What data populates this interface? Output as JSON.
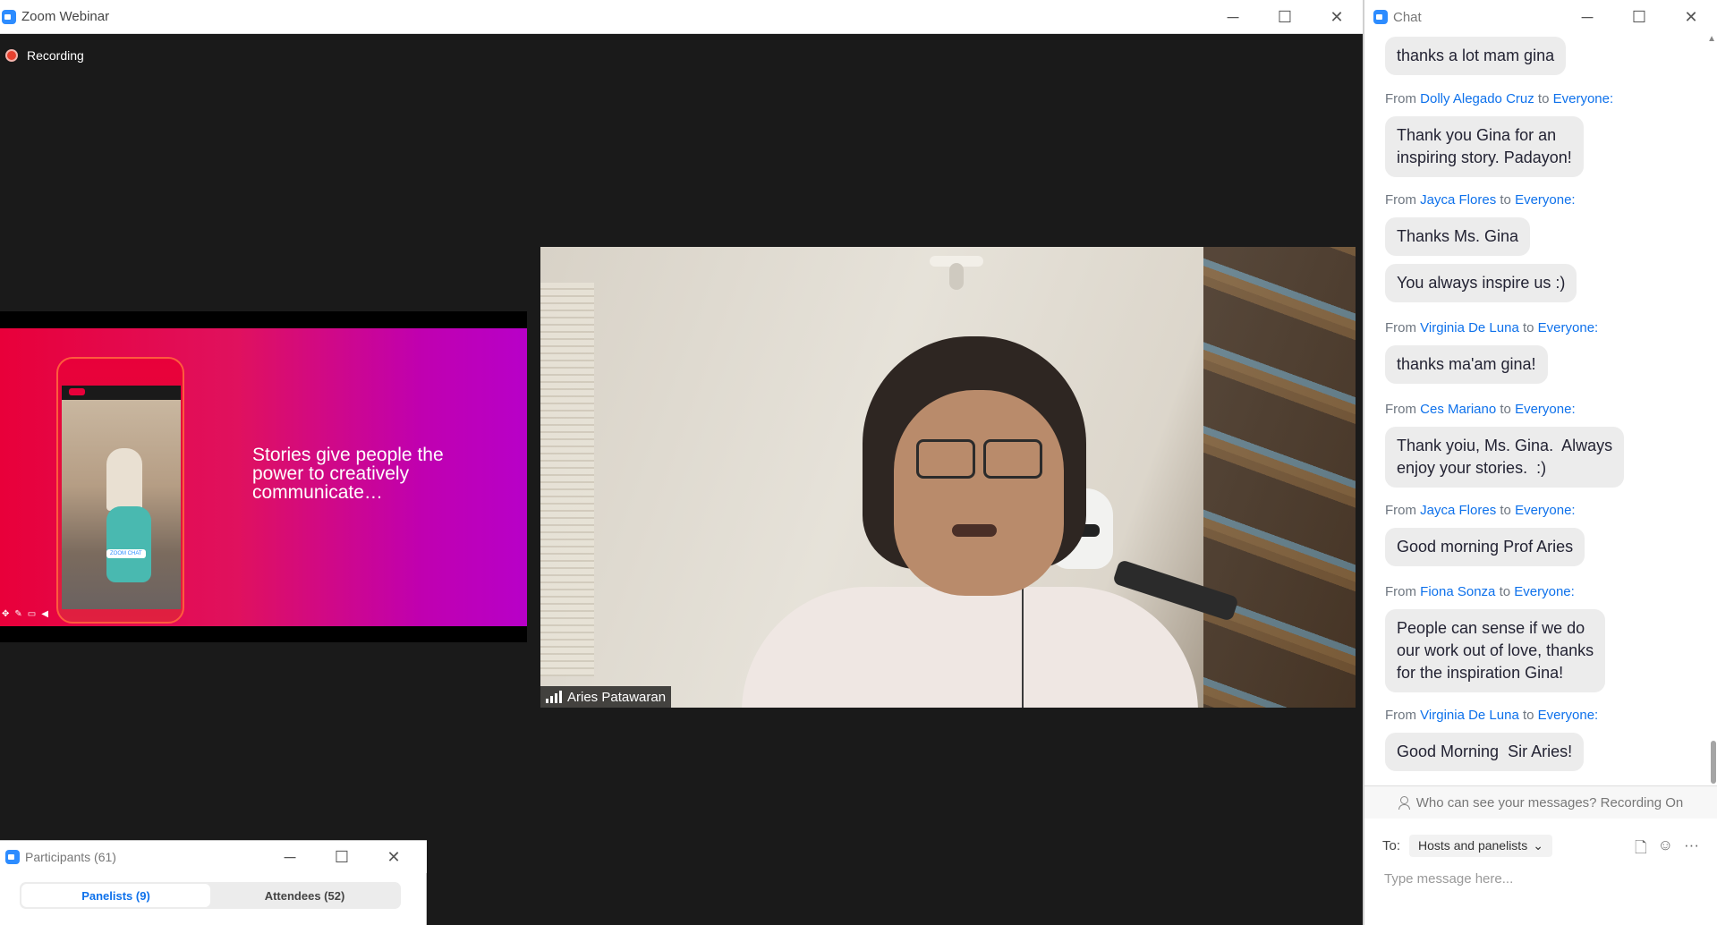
{
  "main_window": {
    "title": "Zoom Webinar",
    "recording_label": "Recording",
    "controls": {
      "minimize": "─",
      "maximize": "☐",
      "close": "✕"
    }
  },
  "slide": {
    "text": "Stories give people the power to creatively communicate…",
    "phone_badge": "ZOOM CHAT"
  },
  "video": {
    "participant_name": "Aries Patawaran"
  },
  "participants_window": {
    "title": "Participants (61)",
    "tabs": [
      {
        "label": "Panelists (9)",
        "active": true
      },
      {
        "label": "Attendees (52)",
        "active": false
      }
    ]
  },
  "chat_window": {
    "title": "Chat",
    "messages": [
      {
        "type": "bubble",
        "text": "thanks a lot mam gina"
      },
      {
        "type": "from",
        "from_prefix": "From",
        "sender": "Dolly Alegado Cruz",
        "to_word": "to",
        "recipient": "Everyone:"
      },
      {
        "type": "bubble",
        "text": "Thank you Gina for an\ninspiring story. Padayon!"
      },
      {
        "type": "from",
        "from_prefix": "From",
        "sender": "Jayca Flores",
        "to_word": "to",
        "recipient": "Everyone:"
      },
      {
        "type": "bubble",
        "text": "Thanks Ms. Gina"
      },
      {
        "type": "bubble",
        "text": "You always inspire us :)"
      },
      {
        "type": "from",
        "from_prefix": "From",
        "sender": "Virginia De Luna",
        "to_word": "to",
        "recipient": "Everyone:"
      },
      {
        "type": "bubble",
        "text": "thanks ma'am gina!"
      },
      {
        "type": "from",
        "from_prefix": "From",
        "sender": "Ces Mariano",
        "to_word": "to",
        "recipient": "Everyone:"
      },
      {
        "type": "bubble",
        "text": "Thank yoiu, Ms. Gina.  Always\nenjoy your stories.  :)"
      },
      {
        "type": "from",
        "from_prefix": "From",
        "sender": "Jayca Flores",
        "to_word": "to",
        "recipient": "Everyone:"
      },
      {
        "type": "bubble",
        "text": "Good morning Prof Aries"
      },
      {
        "type": "from",
        "from_prefix": "From",
        "sender": "Fiona Sonza",
        "to_word": "to",
        "recipient": "Everyone:"
      },
      {
        "type": "bubble",
        "text": "People can sense if we do\nour work out of love, thanks\nfor the inspiration Gina!"
      },
      {
        "type": "from",
        "from_prefix": "From",
        "sender": "Virginia De Luna",
        "to_word": "to",
        "recipient": "Everyone:"
      },
      {
        "type": "bubble",
        "text": "Good Morning  Sir Aries!"
      }
    ],
    "recording_note": "Who can see your messages? Recording On",
    "to_label": "To:",
    "recipient_select": "Hosts and panelists",
    "message_placeholder": "Type message here...",
    "more_label": "···"
  }
}
